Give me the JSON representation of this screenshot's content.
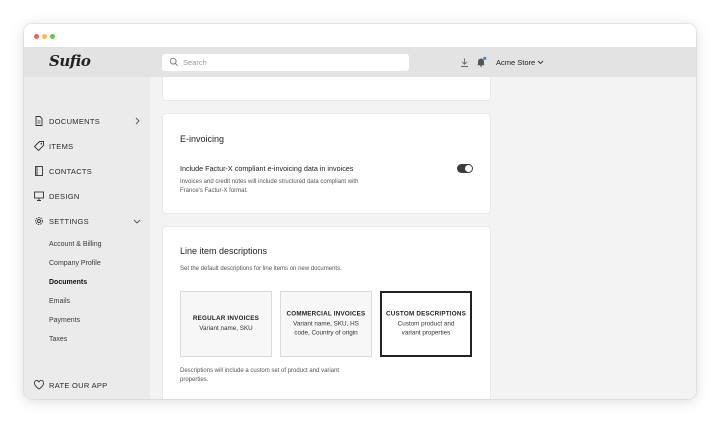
{
  "app": {
    "logo": "Sufio"
  },
  "topbar": {
    "search_placeholder": "Search",
    "store_name": "Acme Store"
  },
  "sidebar": {
    "items": [
      {
        "label": "DOCUMENTS",
        "icon": "document-icon"
      },
      {
        "label": "ITEMS",
        "icon": "tag-icon"
      },
      {
        "label": "CONTACTS",
        "icon": "contacts-book-icon"
      },
      {
        "label": "DESIGN",
        "icon": "monitor-icon"
      },
      {
        "label": "SETTINGS",
        "icon": "gear-icon"
      }
    ],
    "settings_sub": [
      "Account & Billing",
      "Company Profile",
      "Documents",
      "Emails",
      "Payments",
      "Taxes"
    ],
    "active_sub": "Documents",
    "rate": "RATE OUR APP"
  },
  "einvoicing": {
    "title": "E-invoicing",
    "toggle_label": "Include Factur-X compliant e-invoicing data in invoices",
    "toggle_on": true,
    "help_line1": "Invoices and credit notes will include structured data compliant with",
    "help_line2": "France's Factur-X format."
  },
  "line_items": {
    "title": "Line item descriptions",
    "subtitle": "Set the default descriptions for line items on new documents.",
    "options": [
      {
        "title": "REGULAR INVOICES",
        "desc": "Variant name, SKU"
      },
      {
        "title": "COMMERCIAL INVOICES",
        "desc": "Variant name, SKU, HS code, Country of origin"
      },
      {
        "title": "CUSTOM DESCRIPTIONS",
        "desc": "Custom product and variant properties",
        "selected": true
      }
    ],
    "help_line1": "Descriptions will include a custom set of product and variant",
    "help_line2": "properties."
  },
  "colors": {
    "accent_dark": "#222222",
    "notification_dot": "#3a8fd9",
    "sidebar_bg": "#ebebeb"
  }
}
